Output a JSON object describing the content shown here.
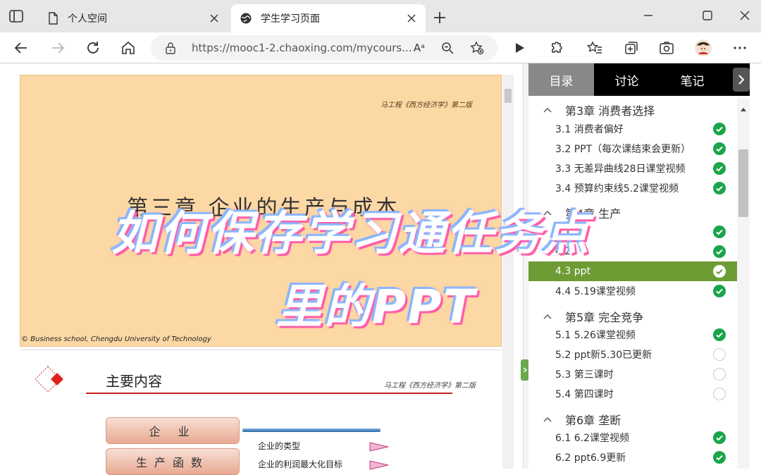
{
  "browser": {
    "tabs": [
      {
        "title": "个人空间",
        "active": false
      },
      {
        "title": "学生学习页面",
        "active": true
      }
    ],
    "url": "https://mooc1-2.chaoxing.com/mycours...",
    "read_aloud_label": "Aᵃ"
  },
  "slide1": {
    "author": "马工程《西方经济学》第二版",
    "title": "第三章   企业的生产与成本",
    "footer": "© Business school, Chengdu University of Technology"
  },
  "slide2": {
    "title": "主要内容",
    "author": "马工程《西方经济学》第二版",
    "pills": [
      "企  业",
      "生产函数"
    ],
    "bullets": [
      "企业的类型",
      "企业的利润最大化目标"
    ]
  },
  "sidebar": {
    "tabs": [
      {
        "label": "目录",
        "active": true
      },
      {
        "label": "讨论",
        "active": false
      },
      {
        "label": "笔记",
        "active": false
      }
    ],
    "chapter3": "第3章  消费者选择",
    "ch3_items": [
      {
        "label": "3.1 消费者偏好",
        "status": "done"
      },
      {
        "label": "3.2 PPT（每次课结束会更新）",
        "status": "done"
      },
      {
        "label": "3.3 无差异曲线28日课堂视频",
        "status": "done"
      },
      {
        "label": "3.4 预算约束线5.2课堂视频",
        "status": "done"
      }
    ],
    "chapter4": "第4章  生产",
    "ch4_items": [
      {
        "label": "4.1",
        "status": "done"
      },
      {
        "label": "4.2",
        "status": "done"
      },
      {
        "label": "4.3 ppt",
        "status": "done",
        "active": true
      },
      {
        "label": "4.4 5.19课堂视频",
        "status": "done"
      }
    ],
    "chapter5": "第5章  完全竞争",
    "ch5_items": [
      {
        "label": "5.1 5.26课堂视频",
        "status": "done"
      },
      {
        "label": "5.2 ppt新5.30已更新",
        "status": "todo"
      },
      {
        "label": "5.3 第三课时",
        "status": "todo"
      },
      {
        "label": "5.4 第四课时",
        "status": "todo"
      }
    ],
    "chapter6": "第6章  垄断",
    "ch6_items": [
      {
        "label": "6.1 6.2课堂视频",
        "status": "done"
      },
      {
        "label": "6.2 ppt6.9更新",
        "status": "done"
      }
    ]
  },
  "overlay": {
    "line1": "如何保存学习通任务点",
    "line2": "里的PPT"
  },
  "colors": {
    "slide_bg": "#fcd8a4",
    "active_lesson": "#6d9b34",
    "done": "#1aa54a",
    "sidebar_tabbar": "#000000"
  }
}
